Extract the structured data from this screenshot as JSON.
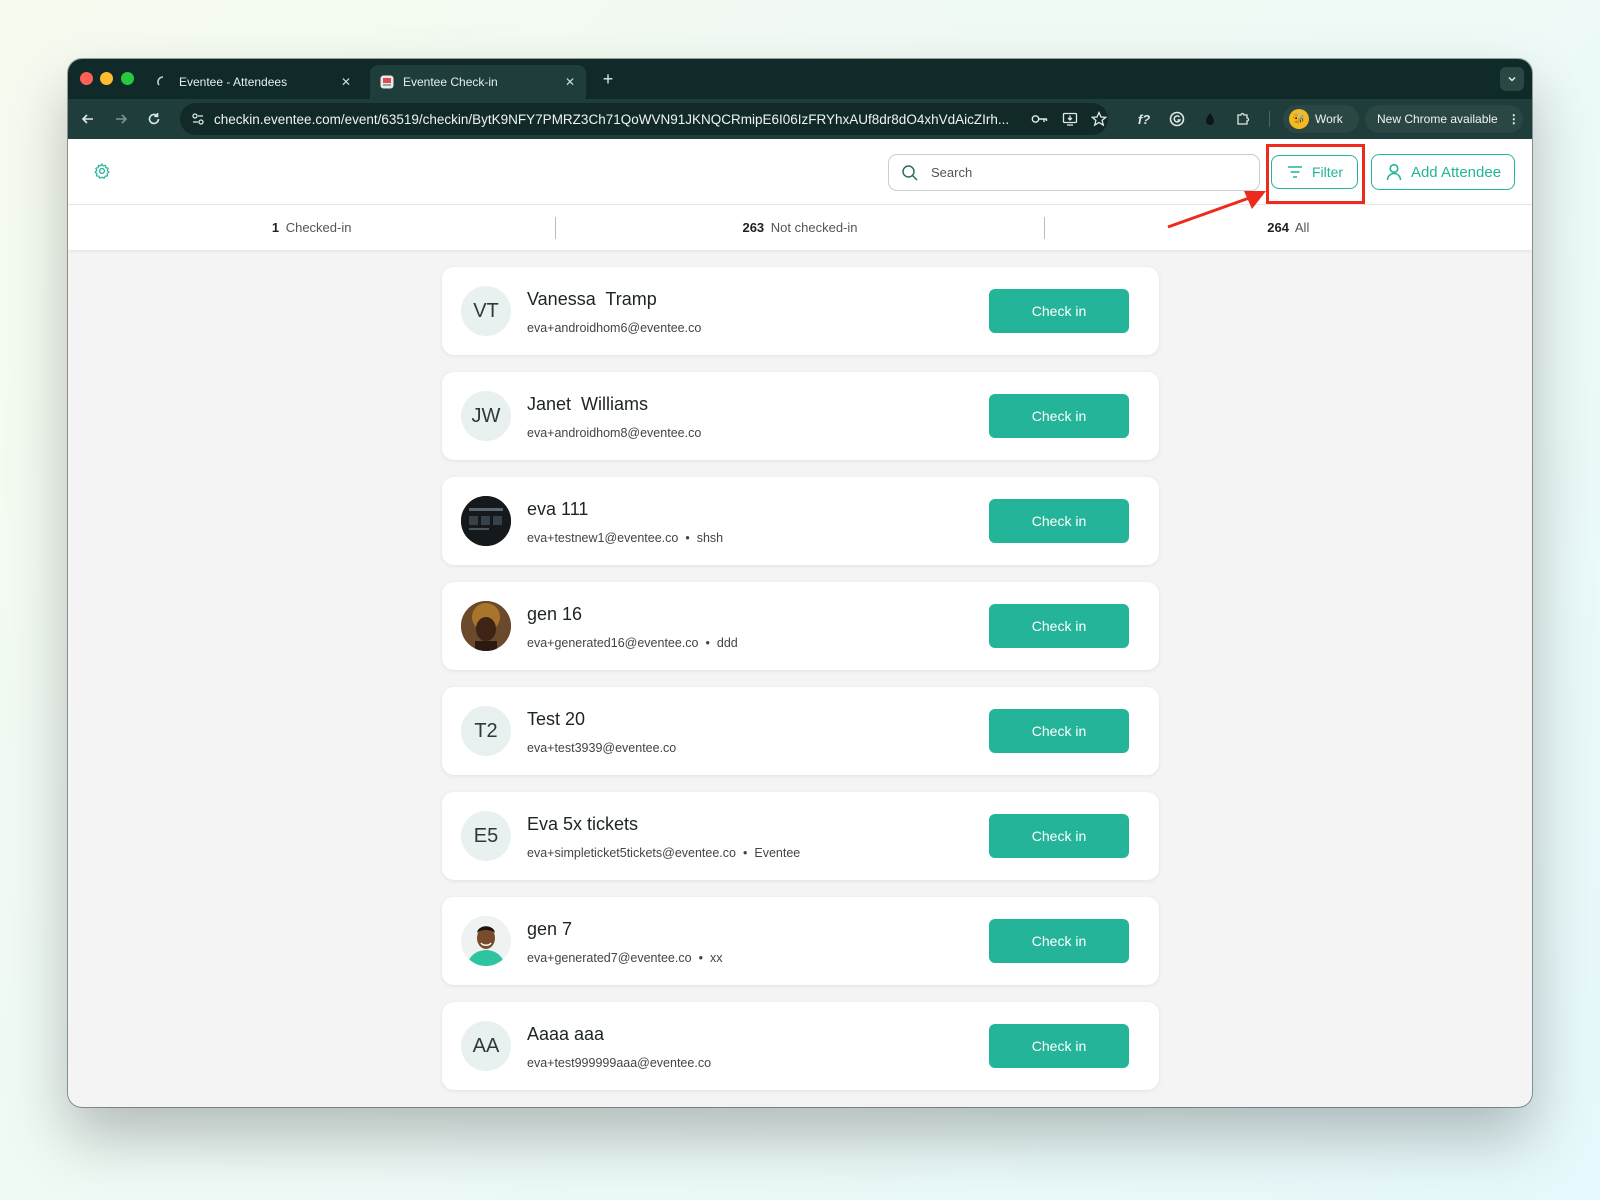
{
  "browser": {
    "tabs": [
      {
        "title": "Eventee - Attendees",
        "active": false
      },
      {
        "title": "Eventee Check-in",
        "active": true
      }
    ],
    "url": "checkin.eventee.com/event/63519/checkin/BytK9NFY7PMRZ3Ch71QoWVN91JKNQCRmipE6I06IzFRYhxAUf8dr8dO4xhVdAicZIrh...",
    "profile_label": "Work",
    "update_label": "New Chrome available"
  },
  "header": {
    "search_placeholder": "Search",
    "filter_label": "Filter",
    "add_attendee_label": "Add Attendee"
  },
  "stats": [
    {
      "count": "1",
      "label": "Checked-in"
    },
    {
      "count": "263",
      "label": "Not checked-in"
    },
    {
      "count": "264",
      "label": "All"
    }
  ],
  "attendees": [
    {
      "initials": "VT",
      "name": "Vanessa  Tramp",
      "email": "eva+androidhom6@eventee.co",
      "extra": "",
      "photo": ""
    },
    {
      "initials": "JW",
      "name": "Janet  Williams",
      "email": "eva+androidhom8@eventee.co",
      "extra": "",
      "photo": ""
    },
    {
      "initials": "",
      "name": "eva 111",
      "email": "eva+testnew1@eventee.co",
      "extra": "shsh",
      "photo": "screen"
    },
    {
      "initials": "",
      "name": "gen 16",
      "email": "eva+generated16@eventee.co",
      "extra": "ddd",
      "photo": "woman"
    },
    {
      "initials": "T2",
      "name": "Test 20",
      "email": "eva+test3939@eventee.co",
      "extra": "",
      "photo": ""
    },
    {
      "initials": "E5",
      "name": "Eva 5x tickets",
      "email": "eva+simpleticket5tickets@eventee.co",
      "extra": "Eventee",
      "photo": ""
    },
    {
      "initials": "",
      "name": "gen 7",
      "email": "eva+generated7@eventee.co",
      "extra": "xx",
      "photo": "man"
    },
    {
      "initials": "AA",
      "name": "Aaaa aaa",
      "email": "eva+test999999aaa@eventee.co",
      "extra": "",
      "photo": ""
    }
  ],
  "checkin_label": "Check in",
  "colors": {
    "accent": "#23b499",
    "annotation": "#ee2a1c",
    "browser_dark": "#0f2a28"
  }
}
